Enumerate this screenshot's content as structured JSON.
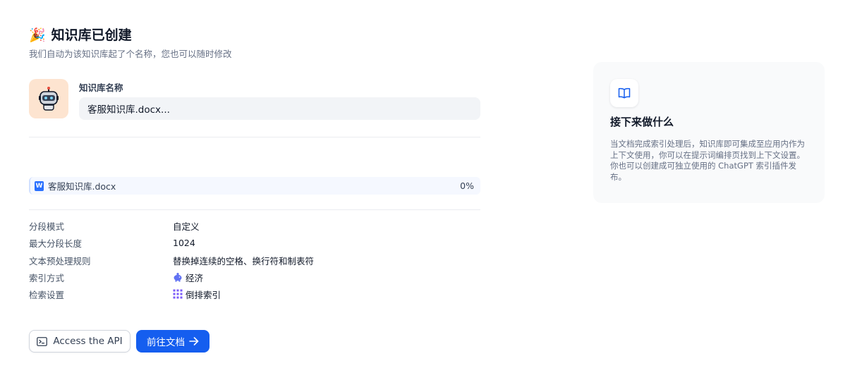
{
  "header": {
    "emoji": "🎉",
    "title": "知识库已创建",
    "subtitle": "我们自动为该知识库起了个名称，您也可以随时修改"
  },
  "dataset": {
    "name_label": "知识库名称",
    "name_value": "客服知识库.docx..."
  },
  "file": {
    "name": "客服知识库.docx",
    "progress": "0%",
    "progress_value": 0
  },
  "settings": [
    {
      "key": "分段模式",
      "value": "自定义",
      "icon": ""
    },
    {
      "key": "最大分段长度",
      "value": "1024",
      "icon": ""
    },
    {
      "key": "文本预处理规则",
      "value": "替换掉连续的空格、换行符和制表符",
      "icon": ""
    },
    {
      "key": "索引方式",
      "value": "经济",
      "icon": "piggy-bank-icon"
    },
    {
      "key": "检索设置",
      "value": "倒排索引",
      "icon": "grid-icon"
    }
  ],
  "actions": {
    "api_label": "Access the API",
    "doc_label": "前往文档"
  },
  "next_steps": {
    "title": "接下来做什么",
    "description": "当文档完成索引处理后，知识库即可集成至应用内作为上下文使用，你可以在提示词编排页找到上下文设置。你也可以创建成可独立使用的 ChatGPT 索引插件发布。"
  },
  "colors": {
    "primary": "#155eef",
    "avatar_bg": "#fde4d0",
    "card_bg": "#f9fafb"
  }
}
